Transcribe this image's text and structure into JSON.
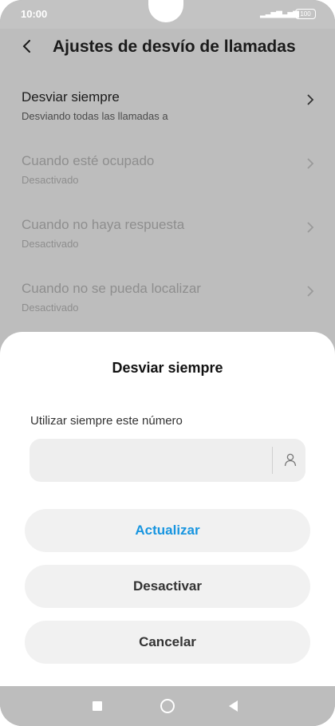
{
  "status_bar": {
    "time": "10:00",
    "battery": "100",
    "signal_icon": "signal-icon"
  },
  "header": {
    "title": "Ajustes de desvío de llamadas",
    "back_icon": "back-arrow-icon"
  },
  "list": [
    {
      "label": "Desviar siempre",
      "sub": "Desviando todas las llamadas a",
      "enabled": true
    },
    {
      "label": "Cuando esté ocupado",
      "sub": "Desactivado",
      "enabled": false
    },
    {
      "label": "Cuando no haya respuesta",
      "sub": "Desactivado",
      "enabled": false
    },
    {
      "label": "Cuando no se pueda localizar",
      "sub": "Desactivado",
      "enabled": false
    }
  ],
  "dialog": {
    "title": "Desviar siempre",
    "field_label": "Utilizar siempre este número",
    "input_value": "",
    "contact_icon": "contact-icon",
    "buttons": {
      "update": "Actualizar",
      "disable": "Desactivar",
      "cancel": "Cancelar"
    },
    "accent_color": "#1795e0"
  },
  "nav": {
    "recent": "recent-apps-icon",
    "home": "home-icon",
    "back": "back-icon"
  }
}
